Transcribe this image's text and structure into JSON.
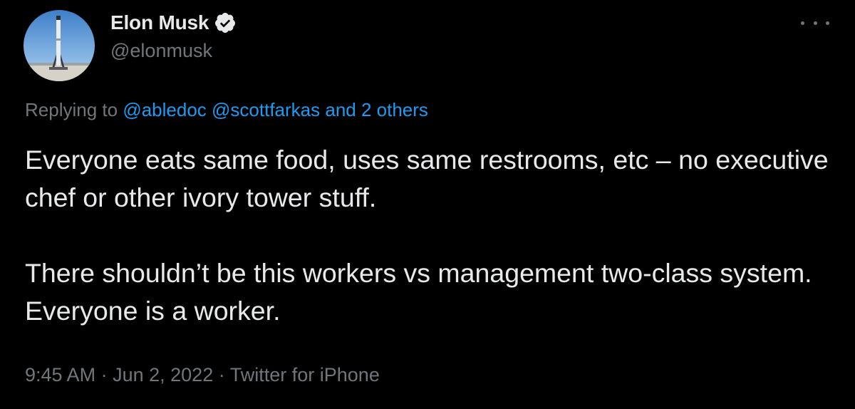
{
  "author": {
    "display_name": "Elon Musk",
    "handle": "@elonmusk",
    "verified": true,
    "avatar_icon": "rocket-launchpad-photo"
  },
  "reply": {
    "prefix": "Replying to ",
    "mentions": [
      "@abledoc",
      "@scottfarkas"
    ],
    "others": "and 2 others"
  },
  "tweet": {
    "paragraphs": [
      "Everyone eats same food, uses same restrooms, etc – no executive chef or other ivory tower stuff.",
      "There shouldn’t be this workers vs management two-class system. Everyone is a worker."
    ]
  },
  "meta": {
    "time": "9:45 AM",
    "separator": "·",
    "date": "Jun 2, 2022",
    "source": "Twitter for iPhone"
  },
  "colors": {
    "background": "#000000",
    "text_primary": "#e7e9ea",
    "text_secondary": "#71767b",
    "link": "#1d9bf0"
  },
  "icons": {
    "verified": "verified-badge-icon",
    "more": "more-options-icon"
  }
}
